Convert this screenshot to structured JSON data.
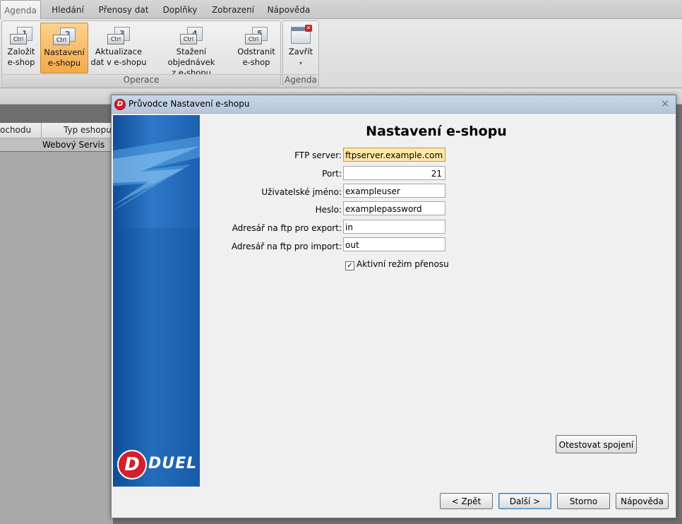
{
  "ribbon_tabs": [
    "Agenda",
    "Hledání",
    "Přenosy dat",
    "Doplňky",
    "Zobrazení",
    "Nápověda"
  ],
  "ribbon": {
    "ctrl_label": "Ctrl",
    "operace": {
      "label": "Operace",
      "buttons": [
        {
          "num": "1",
          "line1": "Založit",
          "line2": "e-shop"
        },
        {
          "num": "2",
          "line1": "Nastavení",
          "line2": "e-shopu"
        },
        {
          "num": "3",
          "line1": "Aktualizace",
          "line2": "dat v e-shopu"
        },
        {
          "num": "4",
          "line1": "Stažení objednávek",
          "line2": "z e-shopu"
        },
        {
          "num": "5",
          "line1": "Odstranit",
          "line2": "e-shop"
        }
      ]
    },
    "agenda": {
      "label": "Agenda",
      "close_label": "Zavřít",
      "arrow": "▾"
    }
  },
  "grid": {
    "col1": "ochodu",
    "col2": "Typ eshopu",
    "row1_type": "Webový Servis"
  },
  "dialog": {
    "app_icon": "D",
    "title": "Průvodce Nastavení e-shopu",
    "close": "×",
    "heading": "Nastavení e-shopu",
    "fields": {
      "ftp_server": {
        "label": "FTP server:",
        "value": "ftpserver.example.com"
      },
      "port": {
        "label": "Port:",
        "value": "21"
      },
      "username": {
        "label": "Uživatelské jméno:",
        "value": "exampleuser"
      },
      "password": {
        "label": "Heslo:",
        "value": "examplepassword"
      },
      "export_dir": {
        "label": "Adresář na ftp pro export:",
        "value": "in"
      },
      "import_dir": {
        "label": "Adresář na ftp pro import:",
        "value": "out"
      }
    },
    "active_mode": {
      "label": "Aktivní režim přenosu",
      "checked": true,
      "mark": "✓"
    },
    "test_button": "Otestovat spojení",
    "buttons": {
      "back": "< Zpět",
      "next": "Další >",
      "cancel": "Storno",
      "help": "Nápověda"
    },
    "logo": {
      "letter": "D",
      "text": "DUEL"
    }
  }
}
